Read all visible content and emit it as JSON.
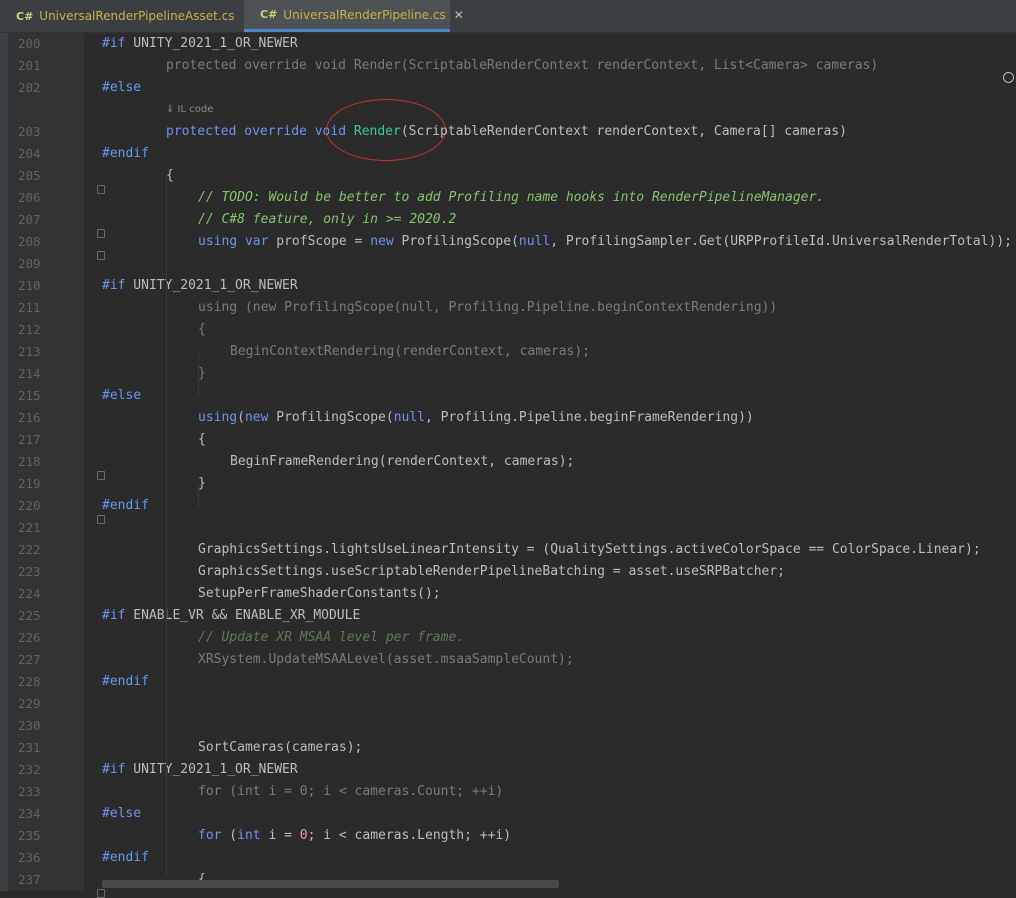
{
  "tabs": [
    {
      "lang": "C#",
      "name": "UniversalRenderPipelineAsset.cs",
      "close": "✕"
    },
    {
      "lang": "C#",
      "name": "UniversalRenderPipeline.cs",
      "close": "✕"
    }
  ],
  "hint": "⇓ IL code",
  "lines": [
    {
      "num": "200",
      "tokens": [
        {
          "t": "#if",
          "c": "dir"
        },
        {
          "t": " UNITY_2021_1_OR_NEWER",
          "c": "plain"
        }
      ]
    },
    {
      "num": "201",
      "tokens": [
        {
          "t": "protected override void Render(ScriptableRenderContext renderContext, List<Camera> cameras)",
          "c": "dim"
        }
      ]
    },
    {
      "num": "202",
      "tokens": [
        {
          "t": "#else",
          "c": "dir"
        }
      ]
    },
    {
      "num": "203",
      "tokens": [
        {
          "t": "protected",
          "c": "kb"
        },
        {
          "t": " ",
          "c": "plain"
        },
        {
          "t": "override",
          "c": "kb"
        },
        {
          "t": " ",
          "c": "plain"
        },
        {
          "t": "void",
          "c": "kb"
        },
        {
          "t": " ",
          "c": "plain"
        },
        {
          "t": "Render",
          "c": "fn-green"
        },
        {
          "t": "(ScriptableRenderContext renderContext, Camera[] cameras)",
          "c": "plain"
        }
      ]
    },
    {
      "num": "204",
      "tokens": [
        {
          "t": "#endif",
          "c": "dir"
        }
      ]
    },
    {
      "num": "205",
      "tokens": [
        {
          "t": "{",
          "c": "plain"
        }
      ]
    },
    {
      "num": "206",
      "tokens": [
        {
          "t": "// TODO: Would be better to add Profiling name hooks into RenderPipelineManager.",
          "c": "cm"
        }
      ]
    },
    {
      "num": "207",
      "tokens": [
        {
          "t": "// C#8 feature, only in >= 2020.2",
          "c": "cm"
        }
      ]
    },
    {
      "num": "208",
      "tokens": [
        {
          "t": "using",
          "c": "kb"
        },
        {
          "t": " ",
          "c": "plain"
        },
        {
          "t": "var",
          "c": "kb"
        },
        {
          "t": " profScope = ",
          "c": "plain"
        },
        {
          "t": "new",
          "c": "kb"
        },
        {
          "t": " ProfilingScope(",
          "c": "plain"
        },
        {
          "t": "null",
          "c": "nul"
        },
        {
          "t": ", ProfilingSampler.Get(URPProfileId.UniversalRenderTotal));",
          "c": "plain"
        }
      ]
    },
    {
      "num": "209",
      "tokens": []
    },
    {
      "num": "210",
      "tokens": [
        {
          "t": "#if",
          "c": "dir"
        },
        {
          "t": " UNITY_2021_1_OR_NEWER",
          "c": "plain"
        }
      ]
    },
    {
      "num": "211",
      "tokens": [
        {
          "t": "using (new ProfilingScope(null, Profiling.Pipeline.beginContextRendering))",
          "c": "dim"
        }
      ]
    },
    {
      "num": "212",
      "tokens": [
        {
          "t": "{",
          "c": "dim"
        }
      ]
    },
    {
      "num": "213",
      "tokens": [
        {
          "t": "BeginContextRendering(renderContext, cameras);",
          "c": "dim"
        }
      ]
    },
    {
      "num": "214",
      "tokens": [
        {
          "t": "}",
          "c": "dim"
        }
      ]
    },
    {
      "num": "215",
      "tokens": [
        {
          "t": "#else",
          "c": "dir"
        }
      ]
    },
    {
      "num": "216",
      "tokens": [
        {
          "t": "using",
          "c": "kb"
        },
        {
          "t": "(",
          "c": "plain"
        },
        {
          "t": "new",
          "c": "kb"
        },
        {
          "t": " ProfilingScope(",
          "c": "plain"
        },
        {
          "t": "null",
          "c": "nul"
        },
        {
          "t": ", Profiling.Pipeline.beginFrameRendering))",
          "c": "plain"
        }
      ]
    },
    {
      "num": "217",
      "tokens": [
        {
          "t": "{",
          "c": "plain"
        }
      ]
    },
    {
      "num": "218",
      "tokens": [
        {
          "t": "BeginFrameRendering(renderContext, cameras);",
          "c": "plain"
        }
      ]
    },
    {
      "num": "219",
      "tokens": [
        {
          "t": "}",
          "c": "plain"
        }
      ]
    },
    {
      "num": "220",
      "tokens": [
        {
          "t": "#endif",
          "c": "dir"
        }
      ]
    },
    {
      "num": "221",
      "tokens": []
    },
    {
      "num": "222",
      "tokens": [
        {
          "t": "GraphicsSettings.lightsUseLinearIntensity = (QualitySettings.activeColorSpace == ColorSpace.Linear);",
          "c": "plain"
        }
      ]
    },
    {
      "num": "223",
      "tokens": [
        {
          "t": "GraphicsSettings.useScriptableRenderPipelineBatching = asset.useSRPBatcher;",
          "c": "plain"
        }
      ]
    },
    {
      "num": "224",
      "tokens": [
        {
          "t": "SetupPerFrameShaderConstants();",
          "c": "plain"
        }
      ]
    },
    {
      "num": "225",
      "tokens": [
        {
          "t": "#if",
          "c": "dir"
        },
        {
          "t": " ENABLE_VR && ENABLE_XR_MODULE",
          "c": "plain"
        }
      ]
    },
    {
      "num": "226",
      "tokens": [
        {
          "t": "// Update XR MSAA level per frame.",
          "c": "cmdim"
        }
      ]
    },
    {
      "num": "227",
      "tokens": [
        {
          "t": "XRSystem.UpdateMSAALevel(asset.msaaSampleCount);",
          "c": "dim"
        }
      ]
    },
    {
      "num": "228",
      "tokens": [
        {
          "t": "#endif",
          "c": "dir"
        }
      ]
    },
    {
      "num": "229",
      "tokens": []
    },
    {
      "num": "230",
      "tokens": []
    },
    {
      "num": "231",
      "tokens": [
        {
          "t": "SortCameras(cameras);",
          "c": "plain"
        }
      ]
    },
    {
      "num": "232",
      "tokens": [
        {
          "t": "#if",
          "c": "dir"
        },
        {
          "t": " UNITY_2021_1_OR_NEWER",
          "c": "plain"
        }
      ]
    },
    {
      "num": "233",
      "tokens": [
        {
          "t": "for (int i = 0; i < cameras.Count; ++i)",
          "c": "dim"
        }
      ]
    },
    {
      "num": "234",
      "tokens": [
        {
          "t": "#else",
          "c": "dir"
        }
      ]
    },
    {
      "num": "235",
      "tokens": [
        {
          "t": "for",
          "c": "kb"
        },
        {
          "t": " (",
          "c": "plain"
        },
        {
          "t": "int",
          "c": "kb"
        },
        {
          "t": " i = ",
          "c": "plain"
        },
        {
          "t": "0",
          "c": "num"
        },
        {
          "t": "; i < cameras.Length; ++i)",
          "c": "plain"
        }
      ]
    },
    {
      "num": "236",
      "tokens": [
        {
          "t": "#endif",
          "c": "dir"
        }
      ]
    },
    {
      "num": "237",
      "tokens": [
        {
          "t": "{",
          "c": "plain"
        }
      ]
    }
  ]
}
